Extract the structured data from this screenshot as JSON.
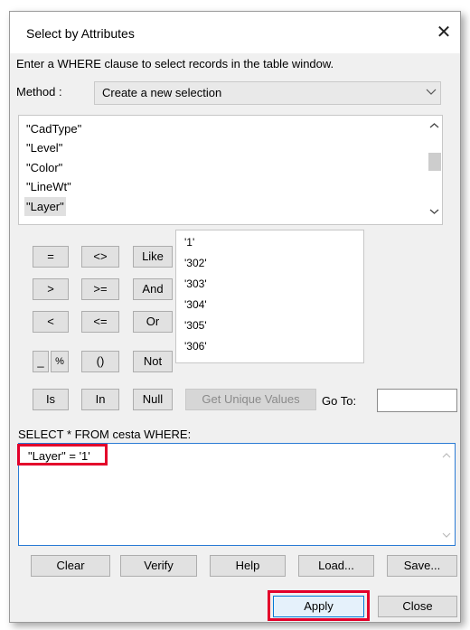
{
  "window": {
    "title": "Select by Attributes",
    "close_glyph": "✕"
  },
  "instructions": "Enter a WHERE clause to select records in the table window.",
  "method": {
    "label": "Method :",
    "value": "Create a new selection"
  },
  "fields": [
    "\"CadType\"",
    "\"Level\"",
    "\"Color\"",
    "\"LineWt\"",
    "\"Layer\""
  ],
  "selected_field": "\"Layer\"",
  "operators": {
    "eq": "=",
    "ne": "<>",
    "like": "Like",
    "gt": ">",
    "ge": ">=",
    "and": "And",
    "lt": "<",
    "le": "<=",
    "or": "Or",
    "underscore": "_",
    "percent": "%",
    "parens": "()",
    "not": "Not",
    "is": "Is",
    "in": "In",
    "null": "Null"
  },
  "values": [
    "'1'",
    "'302'",
    "'303'",
    "'304'",
    "'305'",
    "'306'"
  ],
  "get_unique_values": "Get Unique Values",
  "goto_label": "Go To:",
  "goto_value": "",
  "select_label": "SELECT * FROM cesta WHERE:",
  "where_clause": "\"Layer\" = '1'",
  "buttons": {
    "clear": "Clear",
    "verify": "Verify",
    "help": "Help",
    "load": "Load...",
    "save": "Save...",
    "apply": "Apply",
    "close": "Close"
  },
  "colors": {
    "highlight": "#e3002b",
    "focus_border": "#2a7bd4",
    "dialog_bg": "#f0f0f0"
  },
  "icons": {
    "close": "close-icon",
    "dropdown": "chevron-down-icon",
    "scroll_up": "chevron-up-icon",
    "scroll_down": "chevron-down-icon"
  }
}
